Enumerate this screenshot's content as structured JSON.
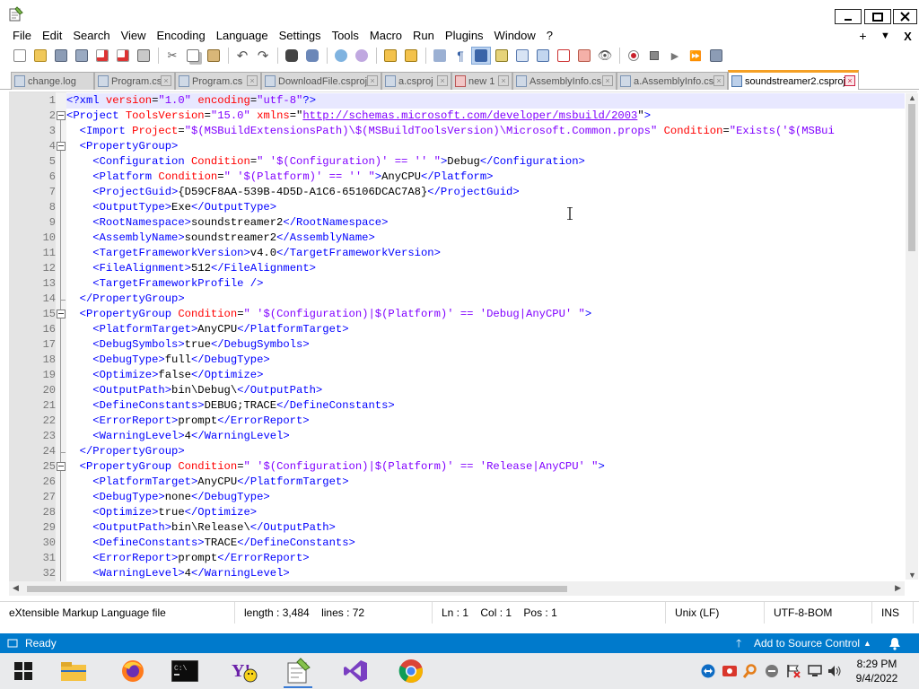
{
  "window": {
    "title_icon": "notepad-icon"
  },
  "menu": [
    "File",
    "Edit",
    "Search",
    "View",
    "Encoding",
    "Language",
    "Settings",
    "Tools",
    "Macro",
    "Run",
    "Plugins",
    "Window",
    "?"
  ],
  "menu_right": {
    "add": "+",
    "dropdown": "▼",
    "close": "X"
  },
  "tabs": [
    {
      "label": "change.log"
    },
    {
      "label": "Program.cs"
    },
    {
      "label": "Program.cs"
    },
    {
      "label": "DownloadFile.csproj"
    },
    {
      "label": "a.csproj"
    },
    {
      "label": "new 1"
    },
    {
      "label": "AssemblyInfo.cs"
    },
    {
      "label": "a.AssemblyInfo.cs"
    },
    {
      "label": "soundstreamer2.csproj",
      "active": true
    }
  ],
  "editor": {
    "line_numbers": [
      "1",
      "2",
      "3",
      "4",
      "5",
      "6",
      "7",
      "8",
      "9",
      "10",
      "11",
      "12",
      "13",
      "14",
      "15",
      "16",
      "17",
      "18",
      "19",
      "20",
      "21",
      "22",
      "23",
      "24",
      "25",
      "26",
      "27",
      "28",
      "29",
      "30",
      "31",
      "32"
    ],
    "lines": [
      [
        [
          "t",
          "<?xml "
        ],
        [
          "a",
          "version"
        ],
        [
          "p",
          "="
        ],
        [
          "v",
          "\"1.0\""
        ],
        [
          "p",
          " "
        ],
        [
          "a",
          "encoding"
        ],
        [
          "p",
          "="
        ],
        [
          "v",
          "\"utf-8\""
        ],
        [
          "t",
          "?>"
        ]
      ],
      [
        [
          "t",
          "<Project "
        ],
        [
          "a",
          "ToolsVersion"
        ],
        [
          "p",
          "="
        ],
        [
          "v",
          "\"15.0\""
        ],
        [
          "p",
          " "
        ],
        [
          "a",
          "xmlns"
        ],
        [
          "p",
          "=\""
        ],
        [
          "u",
          "http://schemas.microsoft.com/developer/msbuild/2003"
        ],
        [
          "p",
          "\""
        ],
        [
          "t",
          ">"
        ]
      ],
      [
        [
          "p",
          "  "
        ],
        [
          "t",
          "<Import "
        ],
        [
          "a",
          "Project"
        ],
        [
          "p",
          "="
        ],
        [
          "v",
          "\"$(MSBuildExtensionsPath)\\$(MSBuildToolsVersion)\\Microsoft.Common.props\""
        ],
        [
          "p",
          " "
        ],
        [
          "a",
          "Condition"
        ],
        [
          "p",
          "="
        ],
        [
          "v",
          "\"Exists('$(MSBui"
        ]
      ],
      [
        [
          "p",
          "  "
        ],
        [
          "t",
          "<PropertyGroup>"
        ]
      ],
      [
        [
          "p",
          "    "
        ],
        [
          "t",
          "<Configuration "
        ],
        [
          "a",
          "Condition"
        ],
        [
          "p",
          "="
        ],
        [
          "v",
          "\" '$(Configuration)' == '' \""
        ],
        [
          "t",
          ">"
        ],
        [
          "p",
          "Debug"
        ],
        [
          "t",
          "</Configuration>"
        ]
      ],
      [
        [
          "p",
          "    "
        ],
        [
          "t",
          "<Platform "
        ],
        [
          "a",
          "Condition"
        ],
        [
          "p",
          "="
        ],
        [
          "v",
          "\" '$(Platform)' == '' \""
        ],
        [
          "t",
          ">"
        ],
        [
          "p",
          "AnyCPU"
        ],
        [
          "t",
          "</Platform>"
        ]
      ],
      [
        [
          "p",
          "    "
        ],
        [
          "t",
          "<ProjectGuid>"
        ],
        [
          "p",
          "{D59CF8AA-539B-4D5D-A1C6-65106DCAC7A8}"
        ],
        [
          "t",
          "</ProjectGuid>"
        ]
      ],
      [
        [
          "p",
          "    "
        ],
        [
          "t",
          "<OutputType>"
        ],
        [
          "p",
          "Exe"
        ],
        [
          "t",
          "</OutputType>"
        ]
      ],
      [
        [
          "p",
          "    "
        ],
        [
          "t",
          "<RootNamespace>"
        ],
        [
          "p",
          "soundstreamer2"
        ],
        [
          "t",
          "</RootNamespace>"
        ]
      ],
      [
        [
          "p",
          "    "
        ],
        [
          "t",
          "<AssemblyName>"
        ],
        [
          "p",
          "soundstreamer2"
        ],
        [
          "t",
          "</AssemblyName>"
        ]
      ],
      [
        [
          "p",
          "    "
        ],
        [
          "t",
          "<TargetFrameworkVersion>"
        ],
        [
          "p",
          "v4.0"
        ],
        [
          "t",
          "</TargetFrameworkVersion>"
        ]
      ],
      [
        [
          "p",
          "    "
        ],
        [
          "t",
          "<FileAlignment>"
        ],
        [
          "p",
          "512"
        ],
        [
          "t",
          "</FileAlignment>"
        ]
      ],
      [
        [
          "p",
          "    "
        ],
        [
          "t",
          "<TargetFrameworkProfile />"
        ]
      ],
      [
        [
          "p",
          "  "
        ],
        [
          "t",
          "</PropertyGroup>"
        ]
      ],
      [
        [
          "p",
          "  "
        ],
        [
          "t",
          "<PropertyGroup "
        ],
        [
          "a",
          "Condition"
        ],
        [
          "p",
          "="
        ],
        [
          "v",
          "\" '$(Configuration)|$(Platform)' == 'Debug|AnyCPU' \""
        ],
        [
          "t",
          ">"
        ]
      ],
      [
        [
          "p",
          "    "
        ],
        [
          "t",
          "<PlatformTarget>"
        ],
        [
          "p",
          "AnyCPU"
        ],
        [
          "t",
          "</PlatformTarget>"
        ]
      ],
      [
        [
          "p",
          "    "
        ],
        [
          "t",
          "<DebugSymbols>"
        ],
        [
          "p",
          "true"
        ],
        [
          "t",
          "</DebugSymbols>"
        ]
      ],
      [
        [
          "p",
          "    "
        ],
        [
          "t",
          "<DebugType>"
        ],
        [
          "p",
          "full"
        ],
        [
          "t",
          "</DebugType>"
        ]
      ],
      [
        [
          "p",
          "    "
        ],
        [
          "t",
          "<Optimize>"
        ],
        [
          "p",
          "false"
        ],
        [
          "t",
          "</Optimize>"
        ]
      ],
      [
        [
          "p",
          "    "
        ],
        [
          "t",
          "<OutputPath>"
        ],
        [
          "p",
          "bin\\Debug\\"
        ],
        [
          "t",
          "</OutputPath>"
        ]
      ],
      [
        [
          "p",
          "    "
        ],
        [
          "t",
          "<DefineConstants>"
        ],
        [
          "p",
          "DEBUG;TRACE"
        ],
        [
          "t",
          "</DefineConstants>"
        ]
      ],
      [
        [
          "p",
          "    "
        ],
        [
          "t",
          "<ErrorReport>"
        ],
        [
          "p",
          "prompt"
        ],
        [
          "t",
          "</ErrorReport>"
        ]
      ],
      [
        [
          "p",
          "    "
        ],
        [
          "t",
          "<WarningLevel>"
        ],
        [
          "p",
          "4"
        ],
        [
          "t",
          "</WarningLevel>"
        ]
      ],
      [
        [
          "p",
          "  "
        ],
        [
          "t",
          "</PropertyGroup>"
        ]
      ],
      [
        [
          "p",
          "  "
        ],
        [
          "t",
          "<PropertyGroup "
        ],
        [
          "a",
          "Condition"
        ],
        [
          "p",
          "="
        ],
        [
          "v",
          "\" '$(Configuration)|$(Platform)' == 'Release|AnyCPU' \""
        ],
        [
          "t",
          ">"
        ]
      ],
      [
        [
          "p",
          "    "
        ],
        [
          "t",
          "<PlatformTarget>"
        ],
        [
          "p",
          "AnyCPU"
        ],
        [
          "t",
          "</PlatformTarget>"
        ]
      ],
      [
        [
          "p",
          "    "
        ],
        [
          "t",
          "<DebugType>"
        ],
        [
          "p",
          "none"
        ],
        [
          "t",
          "</DebugType>"
        ]
      ],
      [
        [
          "p",
          "    "
        ],
        [
          "t",
          "<Optimize>"
        ],
        [
          "p",
          "true"
        ],
        [
          "t",
          "</Optimize>"
        ]
      ],
      [
        [
          "p",
          "    "
        ],
        [
          "t",
          "<OutputPath>"
        ],
        [
          "p",
          "bin\\Release\\"
        ],
        [
          "t",
          "</OutputPath>"
        ]
      ],
      [
        [
          "p",
          "    "
        ],
        [
          "t",
          "<DefineConstants>"
        ],
        [
          "p",
          "TRACE"
        ],
        [
          "t",
          "</DefineConstants>"
        ]
      ],
      [
        [
          "p",
          "    "
        ],
        [
          "t",
          "<ErrorReport>"
        ],
        [
          "p",
          "prompt"
        ],
        [
          "t",
          "</ErrorReport>"
        ]
      ],
      [
        [
          "p",
          "    "
        ],
        [
          "t",
          "<WarningLevel>"
        ],
        [
          "p",
          "4"
        ],
        [
          "t",
          "</WarningLevel>"
        ]
      ]
    ],
    "fold_lines": [
      2,
      4,
      15,
      25
    ]
  },
  "status": {
    "file_type": "eXtensible Markup Language file",
    "length": "length : 3,484",
    "lines": "lines : 72",
    "ln": "Ln : 1",
    "col": "Col : 1",
    "pos": "Pos : 1",
    "eol": "Unix (LF)",
    "encoding": "UTF-8-BOM",
    "mode": "INS"
  },
  "vs_status": {
    "ready": "Ready",
    "source_control": "Add to Source Control"
  },
  "taskbar": {
    "apps": [
      "windows-start-icon",
      "file-explorer-icon",
      "firefox-icon",
      "terminal-icon",
      "yahoo-messenger-icon",
      "notepad-plus-plus-icon",
      "visual-studio-icon",
      "chrome-icon"
    ],
    "time": "8:29 PM",
    "date": "9/4/2022"
  },
  "colors": {
    "tag": "#0000ff",
    "attr": "#ff0000",
    "value": "#8000ff",
    "vs_blue": "#007acc",
    "active_tab_accent": "#f5a025"
  }
}
